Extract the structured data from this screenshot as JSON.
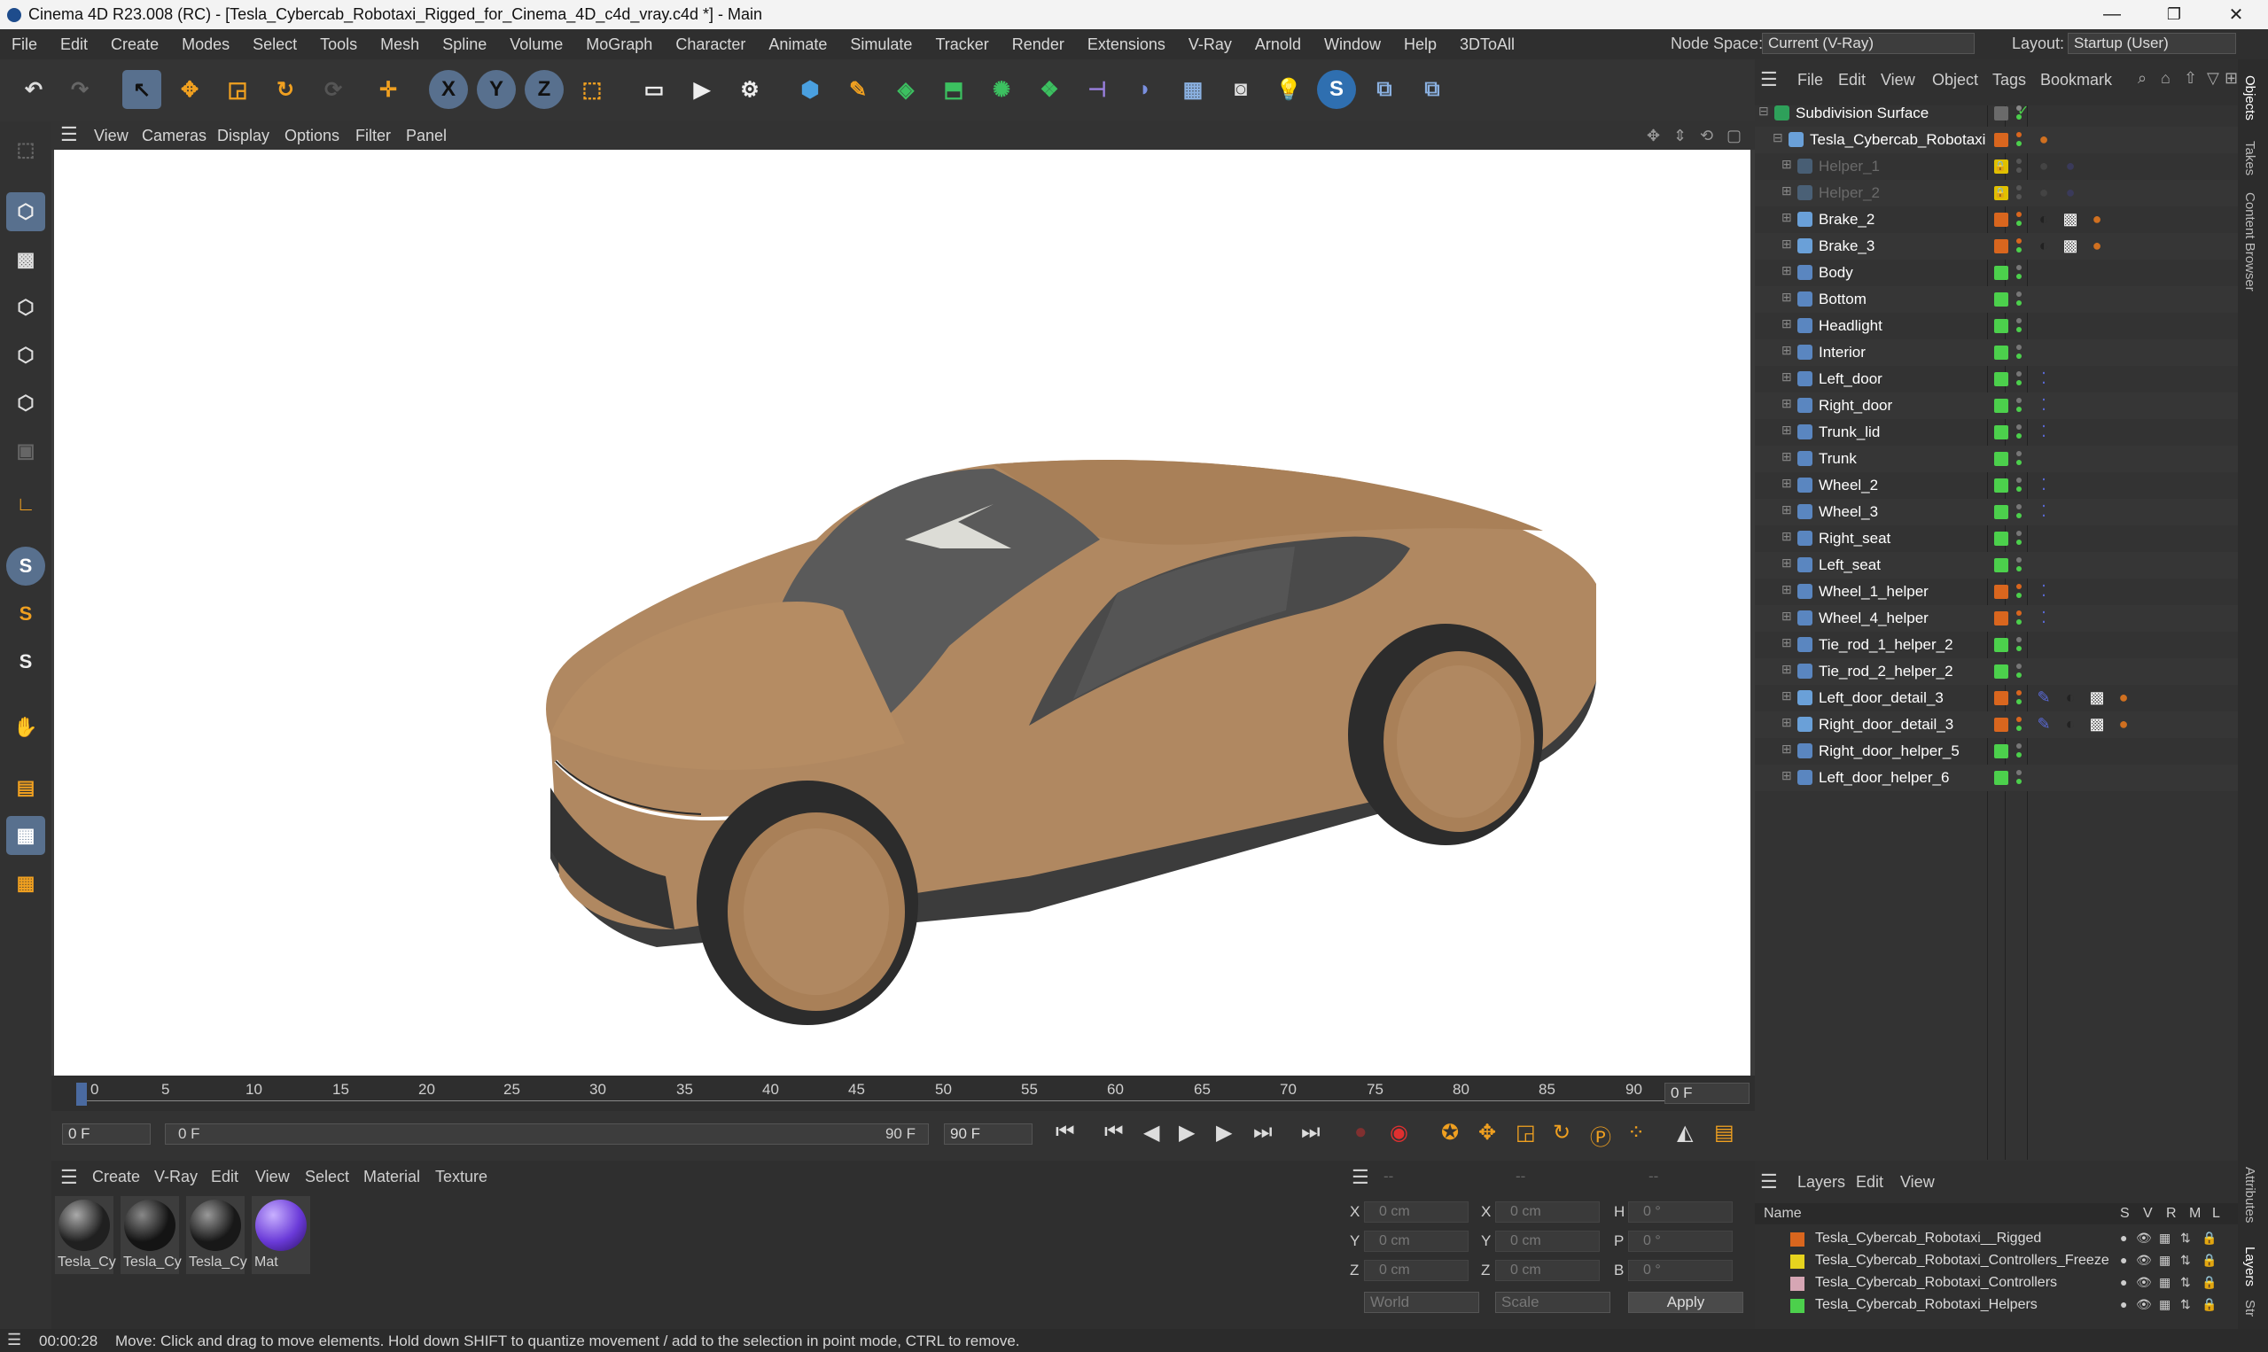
{
  "window": {
    "title": "Cinema 4D R23.008 (RC) - [Tesla_Cybercab_Robotaxi_Rigged_for_Cinema_4D_c4d_vray.c4d *] - Main",
    "min": "—",
    "max": "❐",
    "close": "✕"
  },
  "menubar": {
    "items": [
      "File",
      "Edit",
      "Create",
      "Modes",
      "Select",
      "Tools",
      "Mesh",
      "Spline",
      "Volume",
      "MoGraph",
      "Character",
      "Animate",
      "Simulate",
      "Tracker",
      "Render",
      "Extensions",
      "V-Ray",
      "Arnold",
      "Window",
      "Help",
      "3DToAll"
    ],
    "node_space_label": "Node Space:",
    "node_space_value": "Current (V-Ray)",
    "layout_label": "Layout:",
    "layout_value": "Startup (User)"
  },
  "viewport": {
    "menu": [
      "View",
      "Cameras",
      "Display",
      "Options",
      "Filter",
      "Panel"
    ]
  },
  "timeline": {
    "ticks": [
      "0",
      "5",
      "10",
      "15",
      "20",
      "25",
      "30",
      "35",
      "40",
      "45",
      "50",
      "55",
      "60",
      "65",
      "70",
      "75",
      "80",
      "85",
      "90"
    ],
    "current_frame": "0 F",
    "start_field": "0 F",
    "range_start": "0 F",
    "range_end": "90 F",
    "end_field": "90 F"
  },
  "materials": {
    "menu": [
      "Create",
      "V-Ray",
      "Edit",
      "View",
      "Select",
      "Material",
      "Texture"
    ],
    "items": [
      {
        "label": "Tesla_Cy",
        "color": "#202020"
      },
      {
        "label": "Tesla_Cy",
        "color": "#141414"
      },
      {
        "label": "Tesla_Cy",
        "color": "#181818"
      },
      {
        "label": "Mat",
        "color": "#6a3ad8"
      }
    ]
  },
  "coords": {
    "header": "--",
    "rows": [
      {
        "a": "X",
        "av": "0 cm",
        "b": "X",
        "bv": "0 cm",
        "c": "H",
        "cv": "0 °"
      },
      {
        "a": "Y",
        "av": "0 cm",
        "b": "Y",
        "bv": "0 cm",
        "c": "P",
        "cv": "0 °"
      },
      {
        "a": "Z",
        "av": "0 cm",
        "b": "Z",
        "bv": "0 cm",
        "c": "B",
        "cv": "0 °"
      }
    ],
    "mode": "World",
    "scale": "Scale",
    "apply": "Apply"
  },
  "objects": {
    "menu": [
      "File",
      "Edit",
      "View",
      "Object",
      "Tags",
      "Bookmark"
    ],
    "tree": [
      {
        "name": "Subdivision Surface",
        "color": "#ffffff",
        "icon": "subdivision-icon",
        "indent": 0,
        "vis": "#6a6a6a",
        "dim": false
      },
      {
        "name": "Tesla_Cybercab_Robotaxi",
        "color": "#ffffff",
        "icon": "null-icon",
        "indent": 1,
        "vis": "#d9661e",
        "dim": false
      },
      {
        "name": "Helper_1",
        "color": "#6a6a6a",
        "icon": "joint-icon",
        "indent": 2,
        "vis": "#e0c000",
        "dim": true
      },
      {
        "name": "Helper_2",
        "color": "#6a6a6a",
        "icon": "joint-icon",
        "indent": 2,
        "vis": "#e0c000",
        "dim": true
      },
      {
        "name": "Brake_2",
        "color": "#ffffff",
        "icon": "joint-icon",
        "indent": 2,
        "vis": "#d9661e",
        "dim": false
      },
      {
        "name": "Brake_3",
        "color": "#ffffff",
        "icon": "joint-icon",
        "indent": 2,
        "vis": "#d9661e",
        "dim": false
      },
      {
        "name": "Body",
        "color": "#ffffff",
        "icon": "polygon-icon",
        "indent": 2,
        "vis": "#4cd04c",
        "dim": false
      },
      {
        "name": "Bottom",
        "color": "#ffffff",
        "icon": "polygon-icon",
        "indent": 2,
        "vis": "#4cd04c",
        "dim": false
      },
      {
        "name": "Headlight",
        "color": "#ffffff",
        "icon": "polygon-icon",
        "indent": 2,
        "vis": "#4cd04c",
        "dim": false
      },
      {
        "name": "Interior",
        "color": "#ffffff",
        "icon": "polygon-icon",
        "indent": 2,
        "vis": "#4cd04c",
        "dim": false
      },
      {
        "name": "Left_door",
        "color": "#ffffff",
        "icon": "polygon-icon",
        "indent": 2,
        "vis": "#4cd04c",
        "dim": false
      },
      {
        "name": "Right_door",
        "color": "#ffffff",
        "icon": "polygon-icon",
        "indent": 2,
        "vis": "#4cd04c",
        "dim": false
      },
      {
        "name": "Trunk_lid",
        "color": "#ffffff",
        "icon": "polygon-icon",
        "indent": 2,
        "vis": "#4cd04c",
        "dim": false
      },
      {
        "name": "Trunk",
        "color": "#ffffff",
        "icon": "polygon-icon",
        "indent": 2,
        "vis": "#4cd04c",
        "dim": false
      },
      {
        "name": "Wheel_2",
        "color": "#ffffff",
        "icon": "polygon-icon",
        "indent": 2,
        "vis": "#4cd04c",
        "dim": false
      },
      {
        "name": "Wheel_3",
        "color": "#ffffff",
        "icon": "polygon-icon",
        "indent": 2,
        "vis": "#4cd04c",
        "dim": false
      },
      {
        "name": "Right_seat",
        "color": "#ffffff",
        "icon": "polygon-icon",
        "indent": 2,
        "vis": "#4cd04c",
        "dim": false
      },
      {
        "name": "Left_seat",
        "color": "#ffffff",
        "icon": "polygon-icon",
        "indent": 2,
        "vis": "#4cd04c",
        "dim": false
      },
      {
        "name": "Wheel_1_helper",
        "color": "#ffffff",
        "icon": "polygon-icon",
        "indent": 2,
        "vis": "#d9661e",
        "dim": false
      },
      {
        "name": "Wheel_4_helper",
        "color": "#ffffff",
        "icon": "polygon-icon",
        "indent": 2,
        "vis": "#d9661e",
        "dim": false
      },
      {
        "name": "Tie_rod_1_helper_2",
        "color": "#ffffff",
        "icon": "polygon-icon",
        "indent": 2,
        "vis": "#4cd04c",
        "dim": false
      },
      {
        "name": "Tie_rod_2_helper_2",
        "color": "#ffffff",
        "icon": "polygon-icon",
        "indent": 2,
        "vis": "#4cd04c",
        "dim": false
      },
      {
        "name": "Left_door_detail_3",
        "color": "#ffffff",
        "icon": "joint-icon",
        "indent": 2,
        "vis": "#d9661e",
        "dim": false
      },
      {
        "name": "Right_door_detail_3",
        "color": "#ffffff",
        "icon": "joint-icon",
        "indent": 2,
        "vis": "#d9661e",
        "dim": false
      },
      {
        "name": "Right_door_helper_5",
        "color": "#ffffff",
        "icon": "polygon-icon",
        "indent": 2,
        "vis": "#4cd04c",
        "dim": false
      },
      {
        "name": "Left_door_helper_6",
        "color": "#ffffff",
        "icon": "polygon-icon",
        "indent": 2,
        "vis": "#4cd04c",
        "dim": false
      }
    ]
  },
  "layers": {
    "menu": [
      "Layers",
      "Edit",
      "View"
    ],
    "columns": [
      "Name",
      "S",
      "V",
      "R",
      "M",
      "L"
    ],
    "items": [
      {
        "name": "Tesla_Cybercab_Robotaxi__Rigged",
        "color": "#d9661e"
      },
      {
        "name": "Tesla_Cybercab_Robotaxi_Controllers_Freeze",
        "color": "#e6d31e"
      },
      {
        "name": "Tesla_Cybercab_Robotaxi_Controllers",
        "color": "#d6a6b4"
      },
      {
        "name": "Tesla_Cybercab_Robotaxi_Helpers",
        "color": "#4cd04c"
      }
    ]
  },
  "side_tabs": [
    "Objects",
    "Takes",
    "Content Browser",
    "Attributes",
    "Layers",
    "Str"
  ],
  "status": {
    "time": "00:00:28",
    "message": "Move: Click and drag to move elements. Hold down SHIFT to quantize movement / add to the selection in point mode, CTRL to remove."
  }
}
